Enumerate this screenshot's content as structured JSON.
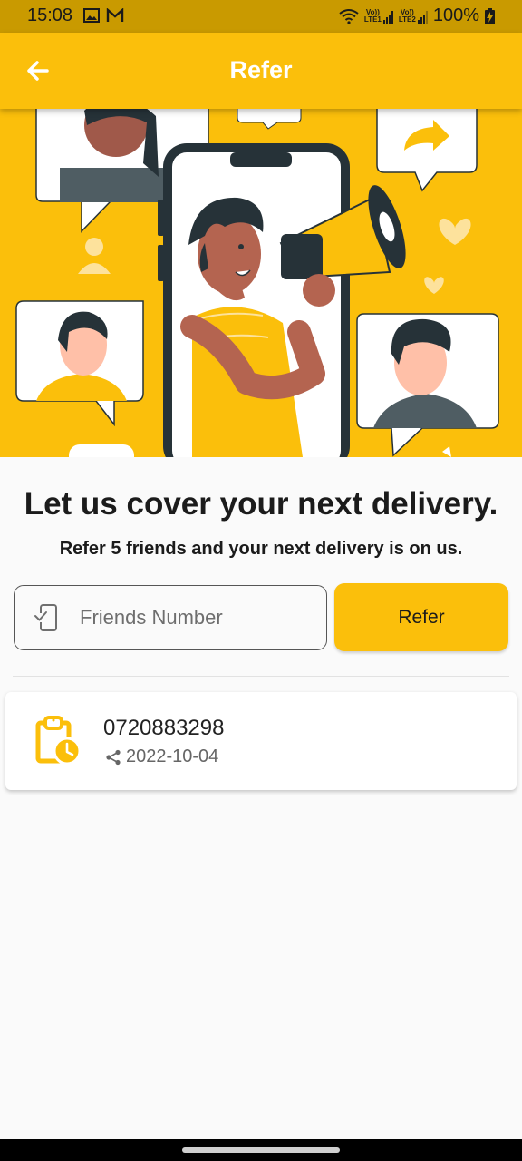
{
  "status_bar": {
    "time": "15:08",
    "battery": "100%",
    "sim1": [
      "Vo))",
      "LTE1"
    ],
    "sim2": [
      "Vo))",
      "LTE2"
    ]
  },
  "app_bar": {
    "title": "Refer",
    "back_icon": "arrow-back-icon"
  },
  "colors": {
    "accent": "#fbbf0b",
    "status_bar": "#c99a00"
  },
  "content": {
    "headline": "Let us cover your next delivery.",
    "subheadline": "Refer 5 friends and your next delivery is on us."
  },
  "form": {
    "phone_input": {
      "placeholder": "Friends Number",
      "value": "",
      "icon": "phone-check-icon"
    },
    "refer_button_label": "Refer"
  },
  "referrals": [
    {
      "phone": "0720883298",
      "date": "2022-10-04",
      "icon": "clipboard-clock-icon",
      "meta_icon": "share-icon"
    }
  ]
}
